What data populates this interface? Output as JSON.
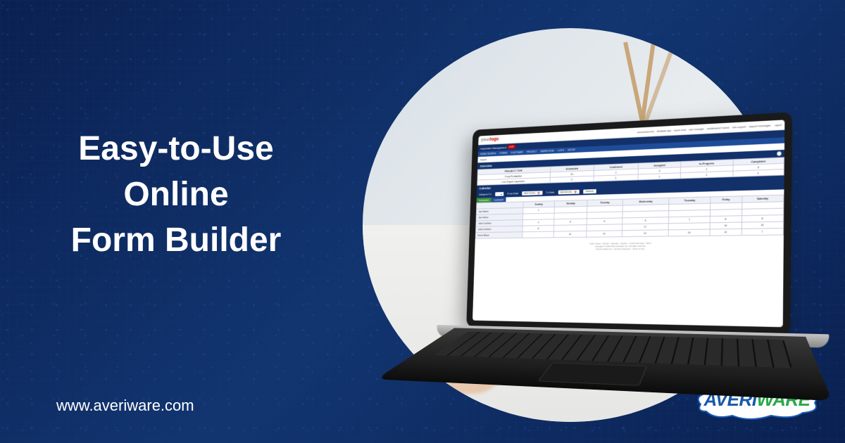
{
  "headline_line1": "Easy-to-Use",
  "headline_line2": "Online",
  "headline_line3": "Form Builder",
  "url": "www.averiware.com",
  "brand_primary": "AVERI",
  "brand_secondary": "WARE",
  "app": {
    "logo_your": "your",
    "logo_logo": "logo",
    "header_links": [
      "announcements",
      "feedback app",
      "report tools",
      "user manager",
      "maintenance+status",
      "new support",
      "support+messages",
      "Logout"
    ],
    "nav_label": "Inspection Management",
    "nav_tag": "LIVE",
    "sub_nav": [
      "HOME SCREEN",
      "FORMS",
      "CUSTOMER",
      "PROJECT",
      "INSPECTION",
      "LISTS",
      "SETUP"
    ],
    "breadcrumb": "Home",
    "overview_title": "Overview",
    "calendar_title": "Calendar",
    "overview": {
      "columns": [
        "PROJECT TYPE",
        "Scheduled",
        "Confirmed",
        "Assigned",
        "In-Progress",
        "Completed"
      ],
      "rows": [
        {
          "type": "Food Production",
          "vals": [
            "15",
            "1",
            "2",
            "1",
            "3"
          ]
        },
        {
          "type": "Live Export Inspection",
          "vals": [
            "3",
            "2",
            "1",
            "2",
            "2"
          ]
        }
      ]
    },
    "calendar_ctrl": {
      "assigned_label": "Assigned To",
      "from_label": "From Date",
      "from_value": "08/07/2021",
      "to_label": "To Date",
      "to_value": "08/13/2021",
      "refresh": "Refresh"
    },
    "view_tabs": {
      "active": "Scheduled",
      "inactive": "Confirmed"
    },
    "calendar": {
      "days": [
        "Sunday",
        "Monday",
        "Tuesday",
        "Wednesday",
        "Thursday",
        "Friday",
        "Saturday"
      ],
      "rows": [
        {
          "label": "Joe Dalton",
          "cells": [
            "1",
            "",
            "",
            "",
            "",
            "",
            ""
          ]
        },
        {
          "label": "Joe Dalton",
          "cells": [
            "",
            "",
            "",
            "",
            "",
            "",
            ""
          ]
        },
        {
          "label": "John Cobbles",
          "cells": [
            "4",
            "5",
            "6",
            "6",
            "7",
            "8",
            "8"
          ]
        },
        {
          "label": "John Cobbles",
          "cells": [
            "8",
            "",
            "",
            "17",
            "",
            "10",
            "10"
          ]
        },
        {
          "label": "Kevin Black",
          "cells": [
            "",
            "11",
            "14",
            "14",
            "14",
            "12",
            "7"
          ]
        }
      ]
    },
    "footer_line1": "Data Classic · Printed · Gateway · Reports · Customize Page · About",
    "footer_line2": "Copyright © 2000-2021 Averiware Inc. All rights reserved.",
    "footer_line3": "Privacy Statement · Security Statement · Terms of Use"
  }
}
